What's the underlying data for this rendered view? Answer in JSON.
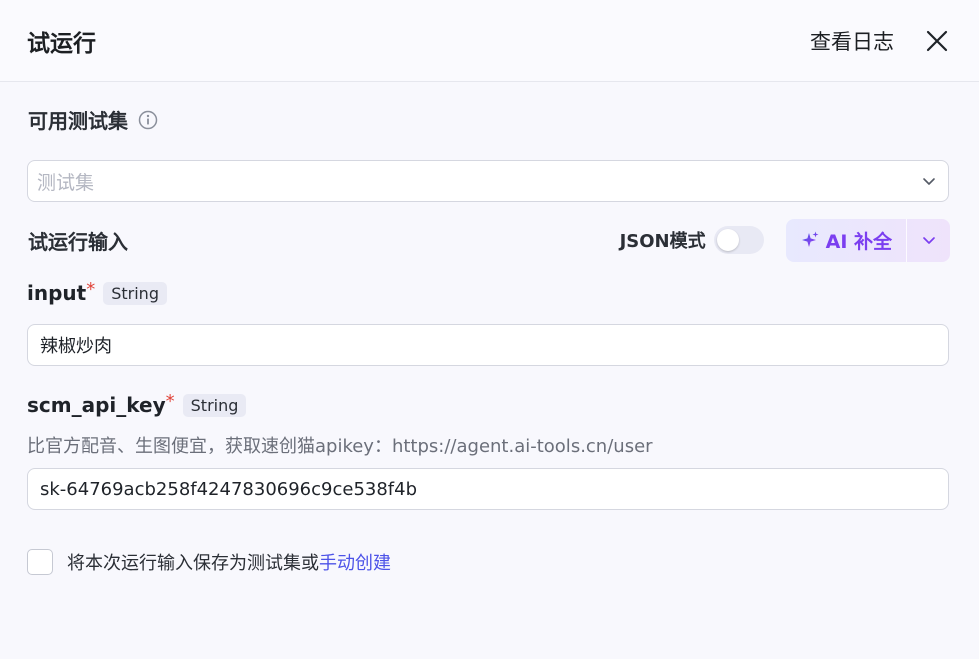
{
  "header": {
    "title": "试运行",
    "view_log_label": "查看日志"
  },
  "testset": {
    "label": "可用测试集",
    "select_placeholder": "测试集"
  },
  "run_input": {
    "label": "试运行输入",
    "json_mode_label": "JSON模式",
    "json_mode_on": false,
    "ai_button_label": "AI 补全"
  },
  "fields": [
    {
      "name": "input",
      "required_mark": "*",
      "type": "String",
      "value": "辣椒炒肉"
    },
    {
      "name": "scm_api_key",
      "required_mark": "*",
      "type": "String",
      "description": "比官方配音、生图便宜，获取速创猫apikey：https://agent.ai-tools.cn/user",
      "value": "sk-64769acb258f4247830696c9ce538f4b"
    }
  ],
  "save": {
    "text": "将本次运行输入保存为测试集或",
    "link_text": "手动创建",
    "checked": false
  },
  "colors": {
    "accent": "#4d53e8",
    "ai_purple": "#7b3ef0",
    "required": "#e0443a"
  }
}
